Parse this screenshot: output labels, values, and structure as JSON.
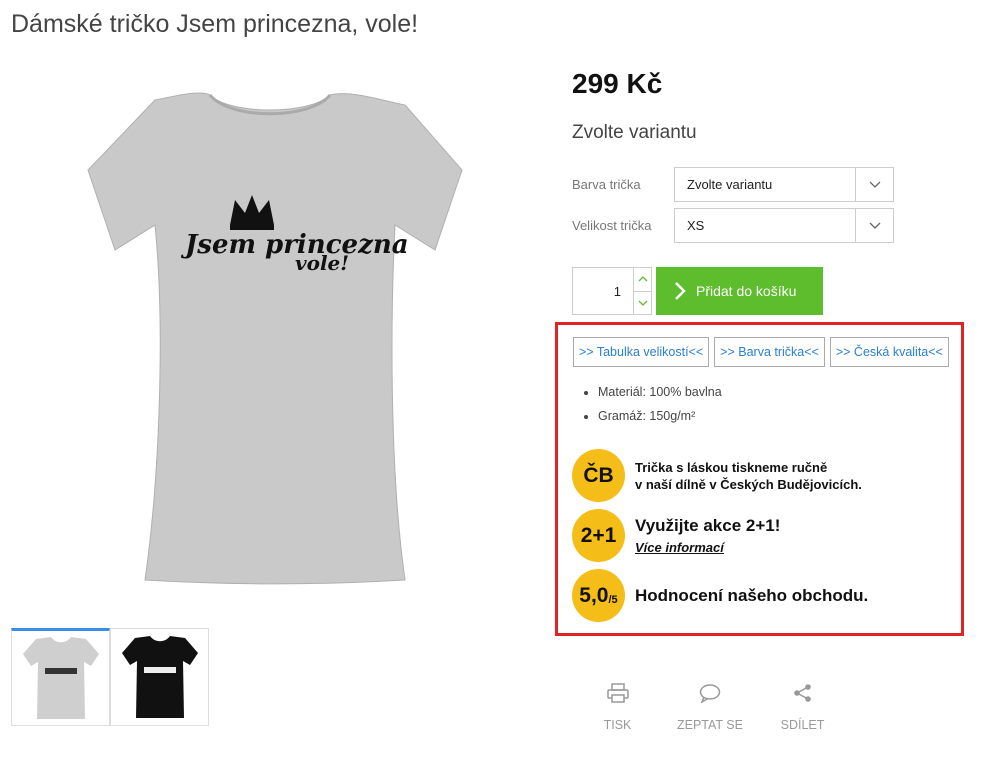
{
  "product": {
    "title": "Dámské tričko Jsem princezna, vole!",
    "price": "299 Kč",
    "variant_heading": "Zvolte variantu",
    "print_line1": "Jsem princezna",
    "print_line2": "vole!"
  },
  "variants": [
    {
      "label": "Barva trička",
      "value": "Zvolte variantu"
    },
    {
      "label": "Velikost trička",
      "value": "XS"
    }
  ],
  "cart": {
    "quantity": "1",
    "add_label": "Přidat do košíku",
    "accent": "#5dbd2c"
  },
  "info": {
    "links": [
      ">> Tabulka velikostí<<",
      ">> Barva trička<<",
      ">> Česká kvalita<<"
    ],
    "specs": [
      "Materiál: 100% bavlna",
      "Gramáž: 150g/m²"
    ],
    "features": [
      {
        "badge": "ČB",
        "line1": "Trička s láskou tiskneme ručně",
        "line2": "v naší dílně v Českých Budějovicích."
      },
      {
        "badge": "2+1",
        "line1": "Využijte akce 2+1!",
        "link": "Více informací"
      },
      {
        "badge": "5,0",
        "badge_small": "/5",
        "line1": "Hodnocení našeho obchodu."
      }
    ],
    "highlight_color": "#e02424",
    "badge_color": "#f5bd18"
  },
  "actions": [
    {
      "label": "TISK",
      "icon": "printer-icon"
    },
    {
      "label": "ZEPTAT SE",
      "icon": "chat-icon"
    },
    {
      "label": "SDÍLET",
      "icon": "share-icon"
    }
  ],
  "gallery": {
    "thumbnails": [
      "white-tshirt",
      "black-tshirt"
    ]
  }
}
